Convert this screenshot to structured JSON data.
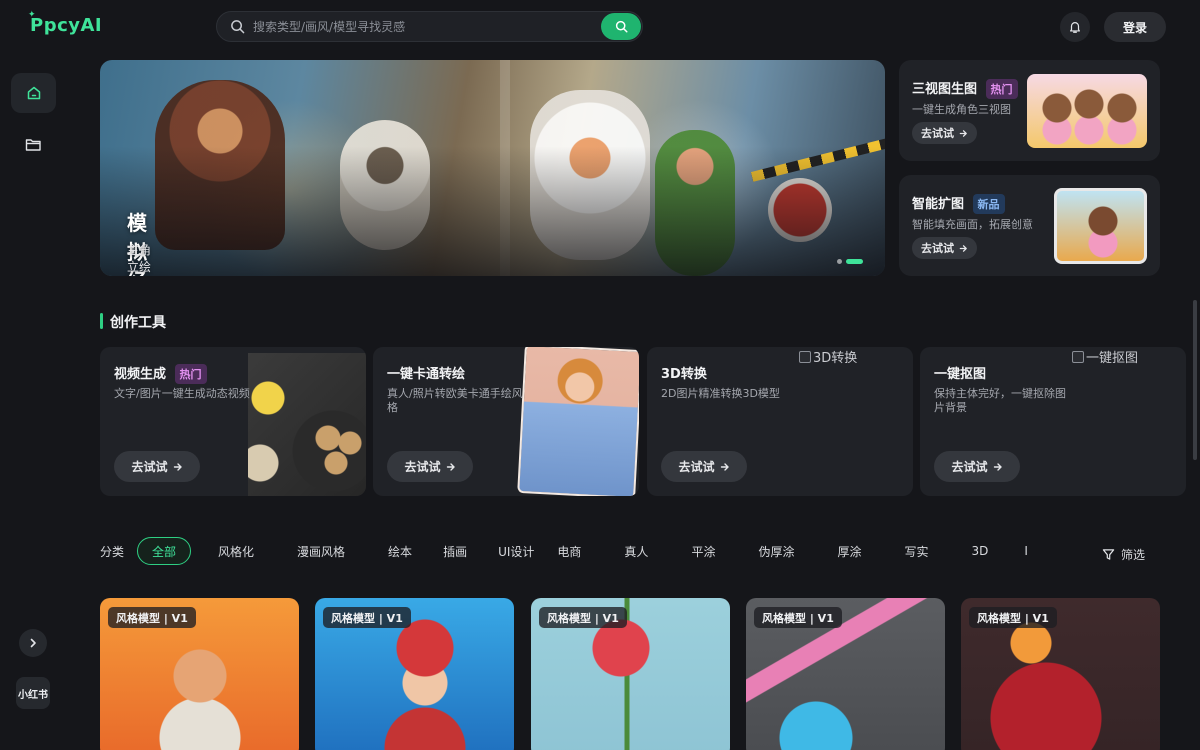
{
  "brand": {
    "logo_text": "PpcyAI",
    "accent": "#3fe39a"
  },
  "search": {
    "placeholder": "搜索类型/画风/模型寻找灵感"
  },
  "header": {
    "login_label": "登录"
  },
  "sidebar": {
    "items": [
      {
        "icon": "home-icon"
      },
      {
        "icon": "folder-icon"
      }
    ],
    "expand_icon": "chevron-right-icon",
    "xhs_label": "小红书"
  },
  "hero": {
    "title": "模拟经营游戏角色设定",
    "subtitle": "主角立绘一键生成：造型、配色、表情同步出，多方案直观对比",
    "slide_index": 2,
    "slide_count": 2
  },
  "feature_cards": [
    {
      "title": "三视图生图",
      "badge": "热门",
      "desc": "一键生成角色三视图",
      "cta": "去试试"
    },
    {
      "title": "智能扩图",
      "badge": "新品",
      "desc": "智能填充画面，拓展创意",
      "cta": "去试试"
    }
  ],
  "tools_section": {
    "title": "创作工具"
  },
  "tools": [
    {
      "title": "视频生成",
      "badge": "热门",
      "desc": "文字/图片一键生成动态视频",
      "cta": "去试试"
    },
    {
      "title": "一键卡通转绘",
      "desc": "真人/照片转欧美卡通手绘风格",
      "cta": "去试试"
    },
    {
      "title": "3D转换",
      "desc": "2D图片精准转换3D模型",
      "cta": "去试试",
      "broken_image_alt": "3D转换"
    },
    {
      "title": "一键抠图",
      "desc": "保持主体完好，一键抠除图片背景",
      "cta": "去试试",
      "broken_image_alt": "一键抠图"
    }
  ],
  "categories": {
    "label": "分类",
    "items": [
      "全部",
      "风格化",
      "漫画风格",
      "绘本",
      "插画",
      "UI设计",
      "电商",
      "真人",
      "平涂",
      "伪厚涂",
      "厚涂",
      "写实",
      "3D",
      "I"
    ],
    "active": "全部",
    "filter_label": "筛选"
  },
  "models": [
    {
      "tag": "风格模型 | V1"
    },
    {
      "tag": "风格模型 | V1"
    },
    {
      "tag": "风格模型 | V1"
    },
    {
      "tag": "风格模型 | V1"
    },
    {
      "tag": "风格模型 | V1"
    }
  ]
}
